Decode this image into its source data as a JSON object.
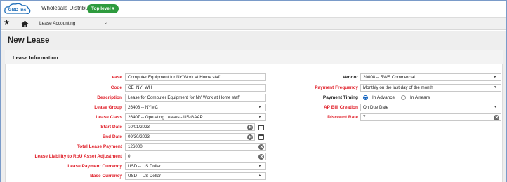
{
  "header": {
    "logo_text": "GBD Inc",
    "company": "Wholesale Distribution",
    "level_button": "Top level"
  },
  "nav": {
    "current": "Lease Accounting"
  },
  "page": {
    "title": "New Lease"
  },
  "section": {
    "title": "Lease Information"
  },
  "left_fields": [
    {
      "label": "Lease",
      "value": "Computer Equipment for NY Work at Home staff"
    },
    {
      "label": "Code",
      "value": "CE_NY_WH"
    },
    {
      "label": "Description",
      "value": "Lease for Computer Equipment for NY Work at Home staff"
    },
    {
      "label": "Lease Group",
      "value": "26408 -- NYMC"
    },
    {
      "label": "Lease Class",
      "value": "26407 -- Operating Leases - US GAAP"
    },
    {
      "label": "Start Date",
      "value": "10/01/2023"
    },
    {
      "label": "End Date",
      "value": "09/30/2023"
    },
    {
      "label": "Total Lease Payment",
      "value": "126000"
    },
    {
      "label": "Lease Liability to RoU Asset Adjustment",
      "value": "0"
    },
    {
      "label": "Lease Payment Currency",
      "value": "USD -- US Dollar"
    },
    {
      "label": "Base Currency",
      "value": "USD -- US Dollar"
    }
  ],
  "right_fields": {
    "vendor": {
      "label": "Vendor",
      "value": "20008 -- RWS Commercial"
    },
    "payment_frequency": {
      "label": "Payment Frequency",
      "value": "Monthly on the last day of the month"
    },
    "payment_timing": {
      "label": "Payment Timing",
      "options": [
        "In Advance",
        "In Arrears"
      ],
      "selected": "In Advance"
    },
    "ap_bill_creation": {
      "label": "AP Bill Creation",
      "value": "On Due Date"
    },
    "discount_rate": {
      "label": "Discount Rate",
      "value": "7"
    }
  },
  "colors": {
    "required_label": "#e0202a",
    "accent_green": "#2e9b3e",
    "radio_blue": "#1565c0"
  }
}
